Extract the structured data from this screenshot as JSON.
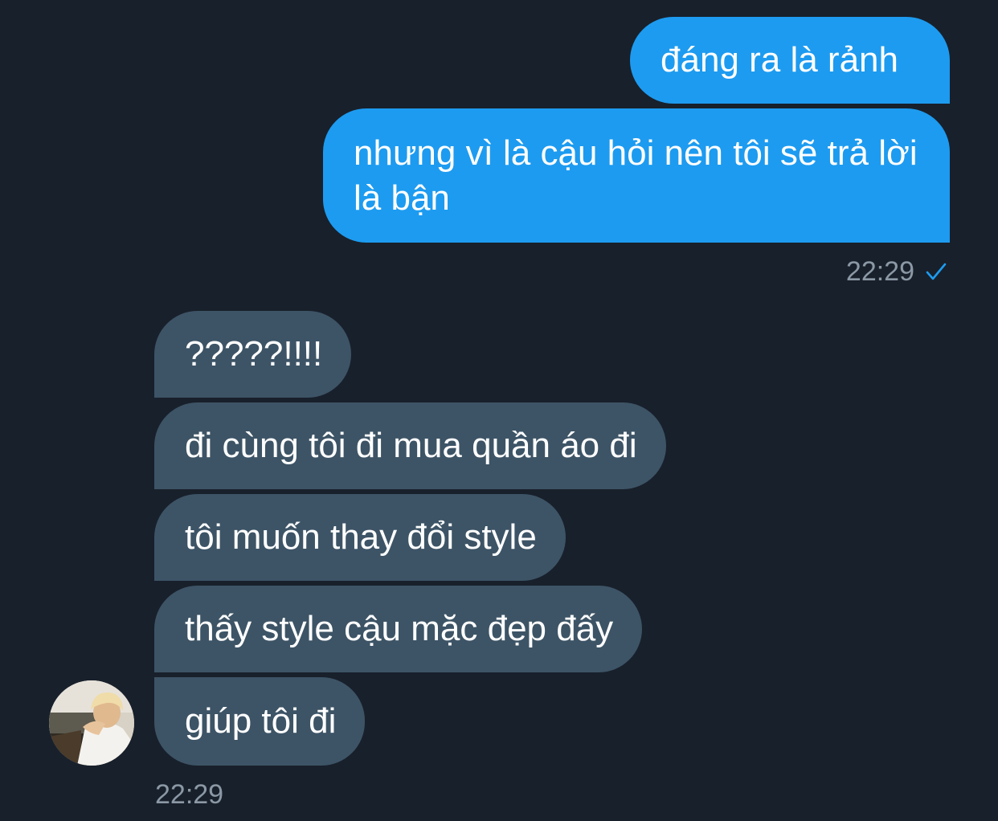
{
  "colors": {
    "background": "#18202b",
    "sent_bubble": "#1d9bf0",
    "received_bubble": "#3d5466",
    "timestamp": "#8b98a5",
    "read_check": "#1d9bf0"
  },
  "conversation": {
    "sent_group": {
      "messages": [
        "đáng ra là rảnh",
        "nhưng vì là cậu hỏi nên tôi sẽ trả lời là bận"
      ],
      "time": "22:29",
      "status_icon": "check-icon"
    },
    "received_group": {
      "avatar_icon": "user-avatar",
      "messages": [
        "?????!!!!",
        "đi cùng tôi đi mua quần áo đi",
        "tôi muốn thay đổi style",
        "thấy style cậu mặc đẹp đấy",
        "giúp tôi đi"
      ],
      "time": "22:29"
    }
  }
}
